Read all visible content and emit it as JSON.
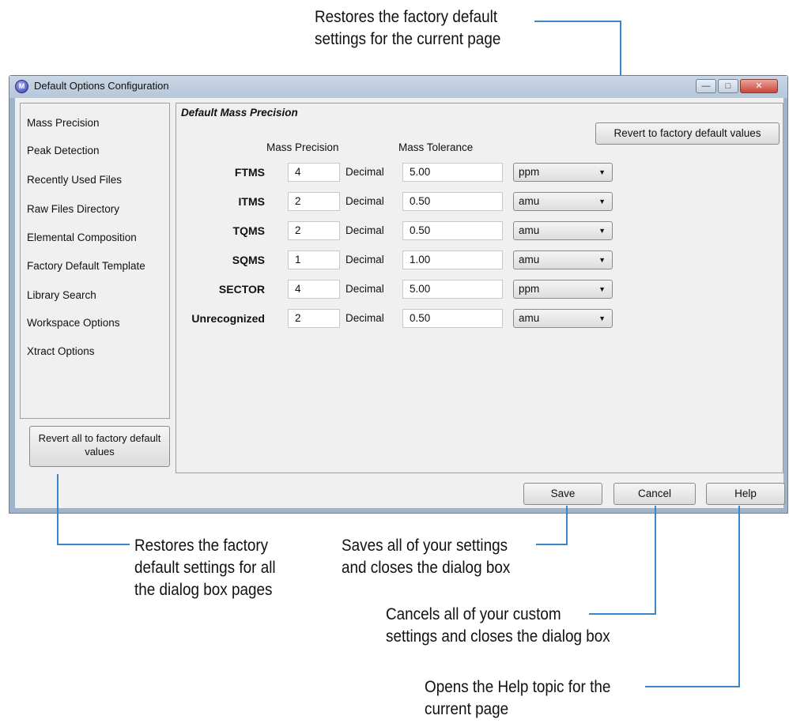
{
  "callouts": {
    "revert_page": [
      "Restores the factory default",
      "settings for the current page"
    ],
    "revert_all": [
      "Restores the factory",
      "default settings for all",
      "the dialog box pages"
    ],
    "save": [
      "Saves all of your settings",
      "and closes the dialog box"
    ],
    "cancel": [
      "Cancels all of your custom",
      "settings and closes the dialog box"
    ],
    "help": [
      "Opens the Help topic for the",
      "current page"
    ]
  },
  "window": {
    "title": "Default Options Configuration",
    "minimize_icon": "minimize-icon",
    "maximize_icon": "maximize-icon",
    "close_icon": "close-icon"
  },
  "sidebar": {
    "items": [
      {
        "label": "Mass Precision"
      },
      {
        "label": "Peak Detection"
      },
      {
        "label": "Recently Used Files"
      },
      {
        "label": "Raw Files Directory"
      },
      {
        "label": "Elemental Composition"
      },
      {
        "label": "Factory Default Template"
      },
      {
        "label": "Library Search"
      },
      {
        "label": "Workspace Options"
      },
      {
        "label": "Xtract Options"
      }
    ],
    "revert_all_label": "Revert all to factory default values"
  },
  "panel": {
    "title": "Default Mass Precision",
    "revert_label": "Revert to factory default values",
    "col_precision": "Mass Precision",
    "col_tolerance": "Mass Tolerance",
    "rows": [
      {
        "label": "FTMS",
        "precision": "4",
        "decimal": "Decimal",
        "tolerance": "5.00",
        "unit": "ppm"
      },
      {
        "label": "ITMS",
        "precision": "2",
        "decimal": "Decimal",
        "tolerance": "0.50",
        "unit": "amu"
      },
      {
        "label": "TQMS",
        "precision": "2",
        "decimal": "Decimal",
        "tolerance": "0.50",
        "unit": "amu"
      },
      {
        "label": "SQMS",
        "precision": "1",
        "decimal": "Decimal",
        "tolerance": "1.00",
        "unit": "amu"
      },
      {
        "label": "SECTOR",
        "precision": "4",
        "decimal": "Decimal",
        "tolerance": "5.00",
        "unit": "ppm"
      },
      {
        "label": "Unrecognized",
        "precision": "2",
        "decimal": "Decimal",
        "tolerance": "0.50",
        "unit": "amu"
      }
    ]
  },
  "buttons": {
    "save": "Save",
    "cancel": "Cancel",
    "help": "Help"
  },
  "colors": {
    "callout_line": "#3b86c6",
    "frame": "#9fb3ca"
  }
}
